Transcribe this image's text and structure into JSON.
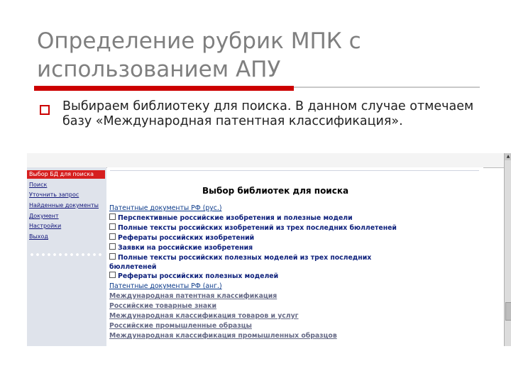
{
  "slide": {
    "title": "Определение рубрик МПК с использованием АПУ",
    "bullet": "Выбираем библиотеку для поиска. В данном случае отмечаем базу «Международная патентная классификация»."
  },
  "menu": {
    "items": [
      "Выбор БД для поиска",
      "Поиск",
      "Уточнить запрос",
      "Найденные документы",
      "Документ",
      "Настройки",
      "Выход"
    ]
  },
  "library": {
    "title": "Выбор библиотек для поиска",
    "items": [
      {
        "text": "Патентные документы РФ (рус.)",
        "kind": "group"
      },
      {
        "text": "Перспективные российские изобретения и полезные модели",
        "kind": "checkbox"
      },
      {
        "text": "Полные тексты российских изобретений из трех последних бюллетеней",
        "kind": "checkbox"
      },
      {
        "text": "Рефераты российских изобретений",
        "kind": "checkbox"
      },
      {
        "text": "Заявки на российские изобретения",
        "kind": "checkbox"
      },
      {
        "text": "Полные тексты российских полезных моделей из трех последних",
        "kind": "checkbox"
      },
      {
        "text": "бюллетеней",
        "kind": "continuation"
      },
      {
        "text": "Рефераты российских полезных моделей",
        "kind": "checkbox"
      },
      {
        "text": "Патентные документы РФ (анг.)",
        "kind": "group"
      },
      {
        "text": "Международная патентная классификация",
        "kind": "link"
      },
      {
        "text": "Российские товарные знаки",
        "kind": "link"
      },
      {
        "text": "Международная классификация товаров и услуг",
        "kind": "link"
      },
      {
        "text": "Российские промышленные образцы",
        "kind": "link"
      },
      {
        "text": "Международная классификация промышленных образцов",
        "kind": "link"
      }
    ]
  },
  "colors": {
    "accent": "#cc0000",
    "title": "#7f7f7f",
    "link": "#0b1e7a"
  }
}
